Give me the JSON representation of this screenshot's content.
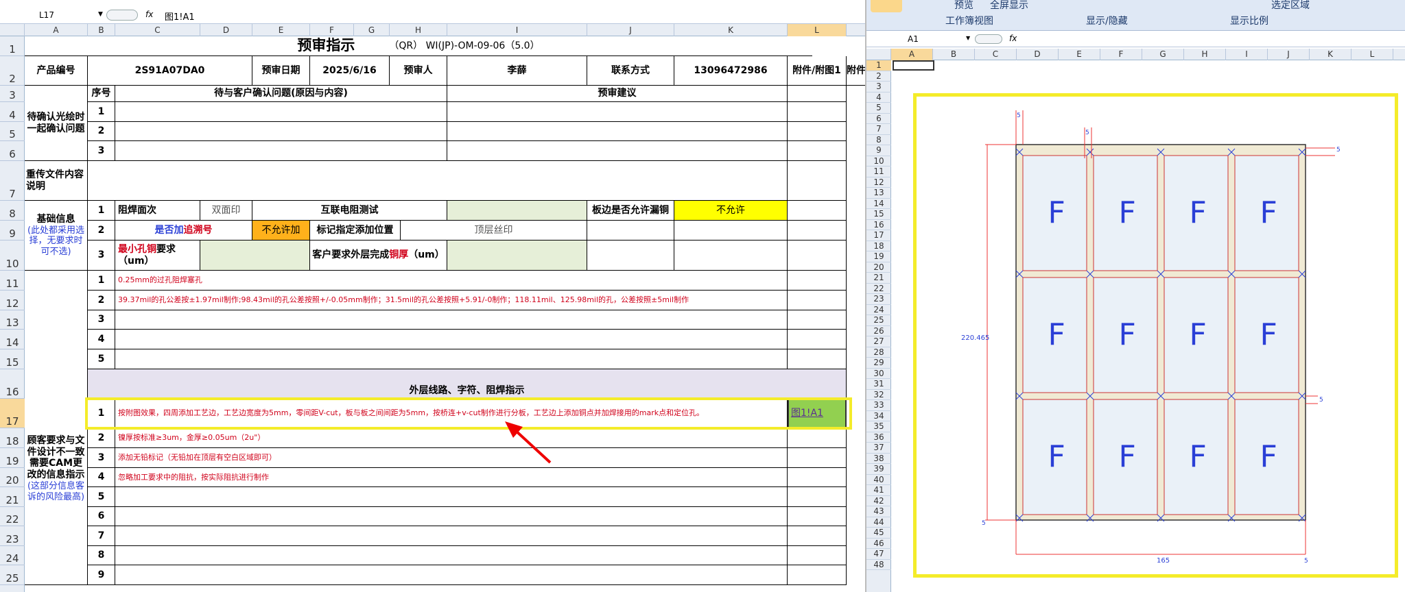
{
  "formula_bar": {
    "cell": "L17",
    "fx": "fx",
    "value": "图1!A1"
  },
  "columns": [
    "A",
    "B",
    "C",
    "D",
    "E",
    "F",
    "G",
    "H",
    "I",
    "J",
    "K",
    "L"
  ],
  "rows": [
    "1",
    "2",
    "3",
    "4",
    "5",
    "6",
    "7",
    "8",
    "9",
    "10",
    "11",
    "12",
    "13",
    "14",
    "15",
    "16",
    "17",
    "18",
    "19",
    "20",
    "21",
    "22",
    "23",
    "24",
    "25"
  ],
  "doc": {
    "title": "预审指示",
    "code": "（QR） WI(JP)-OM-09-06（5.0）",
    "product_label": "产品编号",
    "product_value": "2S91A07DA0",
    "date_label": "预审日期",
    "date_value": "2025/6/16",
    "reviewer_label": "预审人",
    "reviewer_value": "李薛",
    "contact_label": "联系方式",
    "contact_value": "13096472986",
    "attach_label": "附件/附图1",
    "attach_label2": "附件",
    "seq_label": "序号",
    "issue_header": "待与客户确认问题(原因与内容)",
    "advice_header": "预审建议",
    "confirm_label": "待确认光绘时一起确认问题",
    "reupload_label": "重传文件内容说明",
    "basic_label": "基础信息",
    "basic_note": "(此处都采用选择，无要求时可不选)",
    "solder_label": "阻焊面次",
    "solder_value": "双面印",
    "interconnect_label": "互联电阻测试",
    "edge_label": "板边是否允许漏铜",
    "edge_value": "不允许",
    "add_label_a": "是否加",
    "add_label_b": "追溯号",
    "add_value": "不允许加",
    "mark_label": "标记指定添加位置",
    "mark_value": "顶层丝印",
    "min_hole_a": "最小孔铜",
    "min_hole_b": "要求",
    "min_hole_c": "（um）",
    "copper_label_a": "客户要求外层完成",
    "copper_label_b": "铜厚",
    "copper_label_c": "（um）",
    "customer_label": "顾客要求与文件设计不一致需要CAM更改的信息指示",
    "customer_note": "(这部分信息客诉的风险最高)",
    "outer_header": "外层线路、字符、阻焊指示",
    "req1_seq": [
      "1",
      "2",
      "3",
      "4",
      "5"
    ],
    "req1_text": [
      "0.25mm的过孔阻焊塞孔",
      "39.37mil的孔公差按±1.97mil制作;98.43mil的孔公差按照+/-0.05mm制作；31.5mil的孔公差按照+5.91/-0制作；118.11mil、125.98mil的孔，公差按照±5mil制作",
      "",
      "",
      ""
    ],
    "req2_seq": [
      "1",
      "2",
      "3",
      "4",
      "5",
      "6",
      "7",
      "8",
      "9"
    ],
    "req2_text": [
      "按附图效果，四周添加工艺边，工艺边宽度为5mm，零间距V-cut，板与板之间间距为5mm，按桥连+v-cut制作进行分板，工艺边上添加铜点并加焊接用的mark点和定位孔。",
      "镍厚按标准≥3um，金厚≥0.05um（2u\"）",
      "添加无铅标记（无铅加在顶层有空白区域即可）",
      "忽略加工要求中的阻抗，按实际阻抗进行制作",
      "",
      "",
      "",
      "",
      ""
    ],
    "link_text": "图1!A1"
  },
  "right_window": {
    "ribbon": {
      "preview": "预览",
      "fullscreen": "全屏显示",
      "view_group": "工作簿视图",
      "show_group": "显示/隐藏",
      "zoom_group": "显示比例",
      "select_area": "选定区域"
    },
    "cell": "A1",
    "fx": "fx",
    "columns": [
      "A",
      "B",
      "C",
      "D",
      "E",
      "F",
      "G",
      "H",
      "I",
      "J",
      "K",
      "L"
    ],
    "rows": [
      "1",
      "2",
      "3",
      "4",
      "5",
      "6",
      "7",
      "8",
      "9",
      "10",
      "11",
      "12",
      "13",
      "14",
      "15",
      "16",
      "17",
      "18",
      "19",
      "20",
      "21",
      "22",
      "23",
      "24",
      "25",
      "26",
      "27",
      "28",
      "29",
      "30",
      "31",
      "32",
      "33",
      "34",
      "35",
      "36",
      "37",
      "38",
      "39",
      "40",
      "41",
      "42",
      "43",
      "44",
      "45",
      "46",
      "47",
      "48"
    ],
    "drawing": {
      "dim_height": "220.465",
      "dim_width": "165",
      "dim_5": "5",
      "unit_label": "F"
    }
  }
}
